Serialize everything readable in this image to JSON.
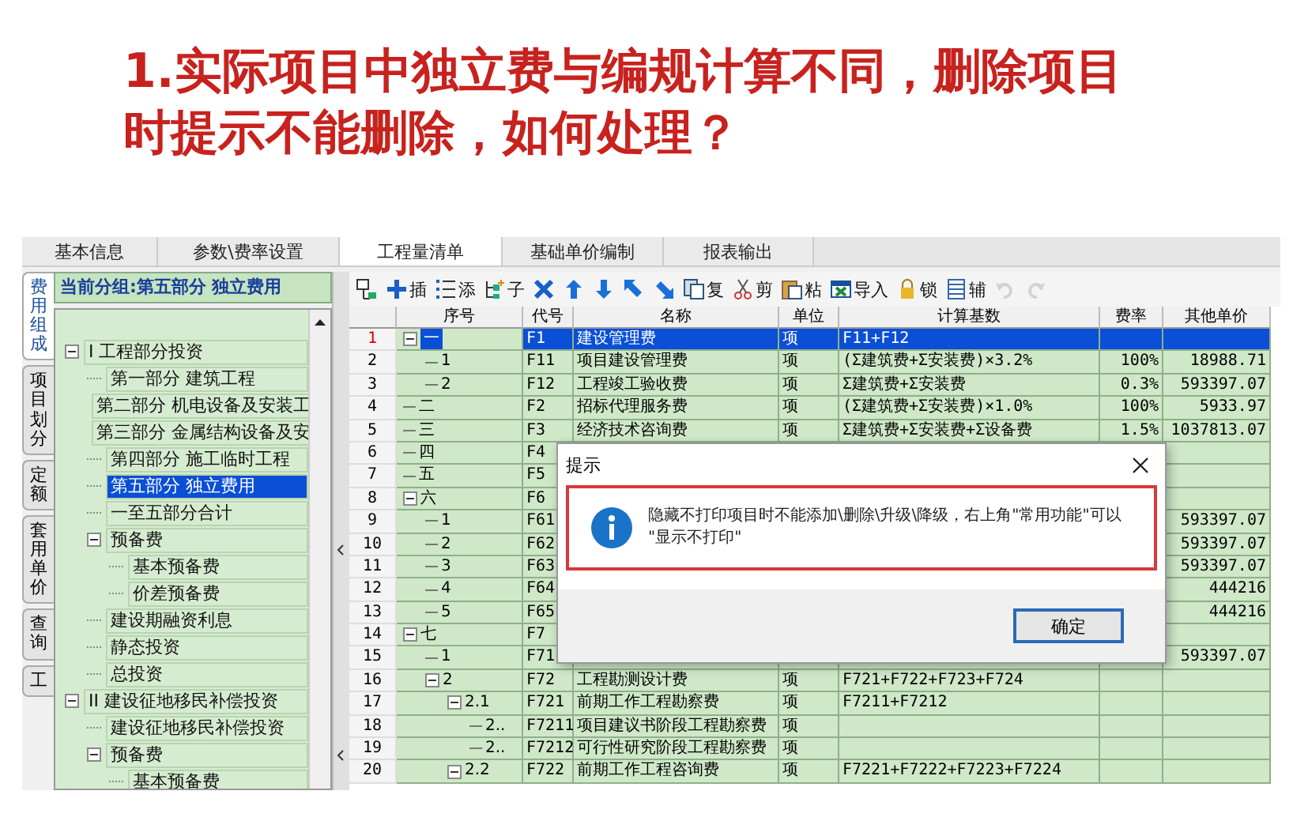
{
  "slide": {
    "title": "1.实际项目中独立费与编规计算不同，删除项目时提示不能删除，如何处理？"
  },
  "app": {
    "tabs": [
      {
        "label": "基本信息",
        "selected": false
      },
      {
        "label": "参数\\费率设置",
        "selected": false
      },
      {
        "label": "工程量清单",
        "selected": true
      },
      {
        "label": "基础单价编制",
        "selected": false
      },
      {
        "label": "报表输出",
        "selected": false
      }
    ],
    "side_tabs": [
      {
        "label": "费用组成",
        "selected": true
      },
      {
        "label": "项目划分",
        "selected": false
      },
      {
        "label": "定额",
        "selected": false
      },
      {
        "label": "套用单价",
        "selected": false
      },
      {
        "label": "查询",
        "selected": false
      },
      {
        "label": "工",
        "selected": false
      }
    ],
    "group_header": "当前分组:第五部分 独立费用",
    "tree": [
      {
        "label": "I 工程部分投资",
        "selected": false,
        "expanded": true,
        "children": [
          {
            "label": "第一部分 建筑工程",
            "selected": false
          },
          {
            "label": "第二部分 机电设备及安装工",
            "selected": false
          },
          {
            "label": "第三部分 金属结构设备及安",
            "selected": false
          },
          {
            "label": "第四部分 施工临时工程",
            "selected": false
          },
          {
            "label": "第五部分 独立费用",
            "selected": true
          },
          {
            "label": "一至五部分合计",
            "selected": false
          },
          {
            "label": "预备费",
            "selected": false,
            "expanded": true,
            "children": [
              {
                "label": "基本预备费",
                "selected": false
              },
              {
                "label": "价差预备费",
                "selected": false
              }
            ]
          },
          {
            "label": "建设期融资利息",
            "selected": false
          },
          {
            "label": "静态投资",
            "selected": false
          },
          {
            "label": "总投资",
            "selected": false
          }
        ]
      },
      {
        "label": "II 建设征地移民补偿投资",
        "selected": false,
        "expanded": true,
        "children": [
          {
            "label": "建设征地移民补偿投资",
            "selected": false
          },
          {
            "label": "预备费",
            "selected": false,
            "expanded": true,
            "children": [
              {
                "label": "基本预备费",
                "selected": false
              }
            ]
          }
        ]
      }
    ],
    "toolbar": [
      {
        "kind": "format",
        "disabled": false
      },
      {
        "kind": "plus",
        "label": "插",
        "disabled": false
      },
      {
        "kind": "list",
        "label": "添",
        "disabled": false
      },
      {
        "kind": "child",
        "label": "子",
        "disabled": false
      },
      {
        "kind": "delete",
        "disabled": false
      },
      {
        "kind": "up",
        "disabled": false
      },
      {
        "kind": "down",
        "disabled": false
      },
      {
        "kind": "upleft",
        "disabled": false
      },
      {
        "kind": "downright",
        "disabled": false
      },
      {
        "kind": "copy",
        "label": "复",
        "disabled": false
      },
      {
        "kind": "cut",
        "label": "剪",
        "disabled": false
      },
      {
        "kind": "paste",
        "label": "粘",
        "disabled": false
      },
      {
        "kind": "import",
        "label": "导入",
        "disabled": false
      },
      {
        "kind": "lock",
        "label": "锁",
        "disabled": false
      },
      {
        "kind": "aux",
        "label": "辅",
        "disabled": false
      },
      {
        "kind": "undo",
        "disabled": true
      },
      {
        "kind": "redo",
        "disabled": true
      }
    ],
    "grid": {
      "columns": [
        "序号",
        "代号",
        "名称",
        "单位",
        "计算基数",
        "费率",
        "其他单价"
      ],
      "rows": [
        {
          "num": "1",
          "seq": "一",
          "code": "F1",
          "name": "建设管理费",
          "unit": "项",
          "base": "F11+F12",
          "selected": true,
          "expanded": true,
          "children": [
            {
              "num": "2",
              "seq": "1",
              "code": "F11",
              "name": "项目建设管理费",
              "unit": "项",
              "base": "(Σ建筑费+Σ安装费)×3.2%",
              "rate": "100%",
              "price": "18988.71",
              "selected": false
            },
            {
              "num": "3",
              "seq": "2",
              "code": "F12",
              "name": "工程竣工验收费",
              "unit": "项",
              "base": "Σ建筑费+Σ安装费",
              "rate": "0.3%",
              "price": "593397.07",
              "selected": false
            }
          ]
        },
        {
          "num": "4",
          "seq": "二",
          "code": "F2",
          "name": "招标代理服务费",
          "unit": "项",
          "base": "(Σ建筑费+Σ安装费)×1.0%",
          "rate": "100%",
          "price": "5933.97",
          "selected": false
        },
        {
          "num": "5",
          "seq": "三",
          "code": "F3",
          "name": "经济技术咨询费",
          "unit": "项",
          "base": "Σ建筑费+Σ安装费+Σ设备费",
          "rate": "1.5%",
          "price": "1037813.07",
          "selected": false
        },
        {
          "num": "6",
          "seq": "四",
          "code": "F4",
          "selected": false
        },
        {
          "num": "7",
          "seq": "五",
          "code": "F5",
          "selected": false
        },
        {
          "num": "8",
          "seq": "六",
          "code": "F6",
          "selected": false,
          "expanded": true,
          "children": [
            {
              "num": "9",
              "seq": "1",
              "code": "F61",
              "price": "593397.07",
              "selected": false
            },
            {
              "num": "10",
              "seq": "2",
              "code": "F62",
              "price": "593397.07",
              "selected": false
            },
            {
              "num": "11",
              "seq": "3",
              "code": "F63",
              "price": "593397.07",
              "selected": false
            },
            {
              "num": "12",
              "seq": "4",
              "code": "F64",
              "price": "444216",
              "selected": false
            },
            {
              "num": "13",
              "seq": "5",
              "code": "F65",
              "price": "444216",
              "selected": false
            }
          ]
        },
        {
          "num": "14",
          "seq": "七",
          "code": "F7",
          "selected": false,
          "expanded": true,
          "children": [
            {
              "num": "15",
              "seq": "1",
              "code": "F71",
              "price": "593397.07",
              "selected": false
            },
            {
              "num": "16",
              "seq": "2",
              "code": "F72",
              "name": "工程勘测设计费",
              "unit": "项",
              "base": "F721+F722+F723+F724",
              "selected": false,
              "expanded": true,
              "children": [
                {
                  "num": "17",
                  "seq": "2.1",
                  "code": "F721",
                  "name": "前期工作工程勘察费",
                  "unit": "项",
                  "base": "F7211+F7212",
                  "selected": false,
                  "expanded": true,
                  "children": [
                    {
                      "num": "18",
                      "seq": "2..",
                      "code": "F7211",
                      "name": "项目建议书阶段工程勘察费",
                      "unit": "项",
                      "selected": false
                    },
                    {
                      "num": "19",
                      "seq": "2..",
                      "code": "F7212",
                      "name": "可行性研究阶段工程勘察费",
                      "unit": "项",
                      "selected": false
                    }
                  ]
                },
                {
                  "num": "20",
                  "seq": "2.2",
                  "code": "F722",
                  "name": "前期工作工程咨询费",
                  "unit": "项",
                  "base": "F7221+F7222+F7223+F7224",
                  "selected": false,
                  "expanded": true
                }
              ]
            }
          ]
        }
      ]
    },
    "dialog": {
      "title": "提示",
      "message": "隐藏不打印项目时不能添加\\删除\\升级\\降级，右上角\"常用功能\"可以 \"显示不打印\"",
      "button": "确定"
    }
  }
}
